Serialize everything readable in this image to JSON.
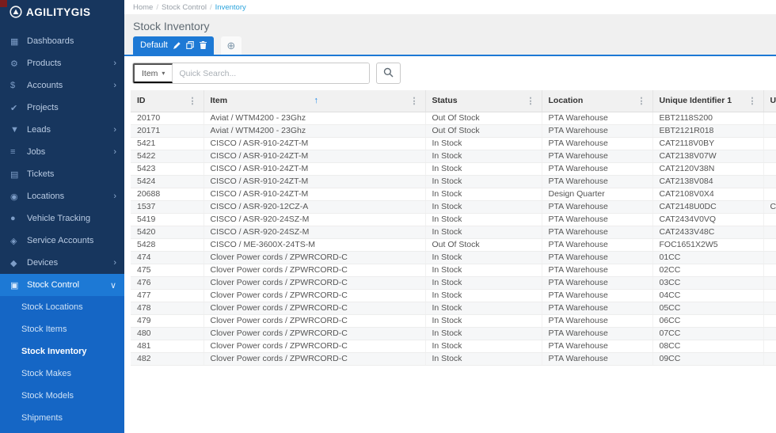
{
  "app": {
    "logo_text": "AGILITYGIS"
  },
  "breadcrumb": {
    "items": [
      "Home",
      "Stock Control",
      "Inventory"
    ],
    "separator": "/"
  },
  "page_title": "Stock Inventory",
  "tabs": {
    "active": "Default"
  },
  "search": {
    "filter_label": "Item",
    "placeholder": "Quick Search..."
  },
  "sidebar": {
    "items": [
      {
        "label": "Dashboards",
        "icon": "dashboards-icon",
        "chevron": null,
        "active": false
      },
      {
        "label": "Products",
        "icon": "products-icon",
        "chevron": "right",
        "active": false
      },
      {
        "label": "Accounts",
        "icon": "accounts-icon",
        "chevron": "right",
        "active": false
      },
      {
        "label": "Projects",
        "icon": "projects-icon",
        "chevron": null,
        "active": false
      },
      {
        "label": "Leads",
        "icon": "leads-icon",
        "chevron": "right",
        "active": false
      },
      {
        "label": "Jobs",
        "icon": "jobs-icon",
        "chevron": "right",
        "active": false
      },
      {
        "label": "Tickets",
        "icon": "tickets-icon",
        "chevron": null,
        "active": false
      },
      {
        "label": "Locations",
        "icon": "locations-icon",
        "chevron": "right",
        "active": false
      },
      {
        "label": "Vehicle Tracking",
        "icon": "vehicle-tracking-icon",
        "chevron": null,
        "active": false
      },
      {
        "label": "Service Accounts",
        "icon": "service-accounts-icon",
        "chevron": null,
        "active": false
      },
      {
        "label": "Devices",
        "icon": "devices-icon",
        "chevron": "right",
        "active": false
      },
      {
        "label": "Stock Control",
        "icon": "stock-control-icon",
        "chevron": "down",
        "active": true
      }
    ],
    "submenu": {
      "items": [
        "Stock Locations",
        "Stock Items",
        "Stock Inventory",
        "Stock Makes",
        "Stock Models",
        "Shipments"
      ],
      "active": "Stock Inventory"
    }
  },
  "table": {
    "columns": [
      "ID",
      "Item",
      "Status",
      "Location",
      "Unique Identifier 1",
      "U"
    ],
    "sorted_column": "Item",
    "sort_direction": "asc",
    "rows": [
      [
        "20170",
        "Aviat / WTM4200 - 23Ghz",
        "Out Of Stock",
        "PTA Warehouse",
        "EBT2118S200",
        ""
      ],
      [
        "20171",
        "Aviat / WTM4200 - 23Ghz",
        "Out Of Stock",
        "PTA Warehouse",
        "EBT2121R018",
        ""
      ],
      [
        "5421",
        "CISCO / ASR-910-24ZT-M",
        "In Stock",
        "PTA Warehouse",
        "CAT2118V0BY",
        ""
      ],
      [
        "5422",
        "CISCO / ASR-910-24ZT-M",
        "In Stock",
        "PTA Warehouse",
        "CAT2138V07W",
        ""
      ],
      [
        "5423",
        "CISCO / ASR-910-24ZT-M",
        "In Stock",
        "PTA Warehouse",
        "CAT2120V38N",
        ""
      ],
      [
        "5424",
        "CISCO / ASR-910-24ZT-M",
        "In Stock",
        "PTA Warehouse",
        "CAT2138V084",
        ""
      ],
      [
        "20688",
        "CISCO / ASR-910-24ZT-M",
        "In Stock",
        "Design Quarter",
        "CAT2108V0X4",
        ""
      ],
      [
        "1537",
        "CISCO / ASR-920-12CZ-A",
        "In Stock",
        "PTA Warehouse",
        "CAT2148U0DC",
        "C"
      ],
      [
        "5419",
        "CISCO / ASR-920-24SZ-M",
        "In Stock",
        "PTA Warehouse",
        "CAT2434V0VQ",
        ""
      ],
      [
        "5420",
        "CISCO / ASR-920-24SZ-M",
        "In Stock",
        "PTA Warehouse",
        "CAT2433V48C",
        ""
      ],
      [
        "5428",
        "CISCO / ME-3600X-24TS-M",
        "Out Of Stock",
        "PTA Warehouse",
        "FOC1651X2W5",
        ""
      ],
      [
        "474",
        "Clover Power cords / ZPWRCORD-C",
        "In Stock",
        "PTA Warehouse",
        "01CC",
        ""
      ],
      [
        "475",
        "Clover Power cords / ZPWRCORD-C",
        "In Stock",
        "PTA Warehouse",
        "02CC",
        ""
      ],
      [
        "476",
        "Clover Power cords / ZPWRCORD-C",
        "In Stock",
        "PTA Warehouse",
        "03CC",
        ""
      ],
      [
        "477",
        "Clover Power cords / ZPWRCORD-C",
        "In Stock",
        "PTA Warehouse",
        "04CC",
        ""
      ],
      [
        "478",
        "Clover Power cords / ZPWRCORD-C",
        "In Stock",
        "PTA Warehouse",
        "05CC",
        ""
      ],
      [
        "479",
        "Clover Power cords / ZPWRCORD-C",
        "In Stock",
        "PTA Warehouse",
        "06CC",
        ""
      ],
      [
        "480",
        "Clover Power cords / ZPWRCORD-C",
        "In Stock",
        "PTA Warehouse",
        "07CC",
        ""
      ],
      [
        "481",
        "Clover Power cords / ZPWRCORD-C",
        "In Stock",
        "PTA Warehouse",
        "08CC",
        ""
      ],
      [
        "482",
        "Clover Power cords / ZPWRCORD-C",
        "In Stock",
        "PTA Warehouse",
        "09CC",
        ""
      ]
    ]
  },
  "colors": {
    "accent": "#1d79d5",
    "sidebar_bg": "#17365e",
    "submenu_bg": "#1566c5",
    "breadcrumb_link": "#2aa3dc"
  }
}
